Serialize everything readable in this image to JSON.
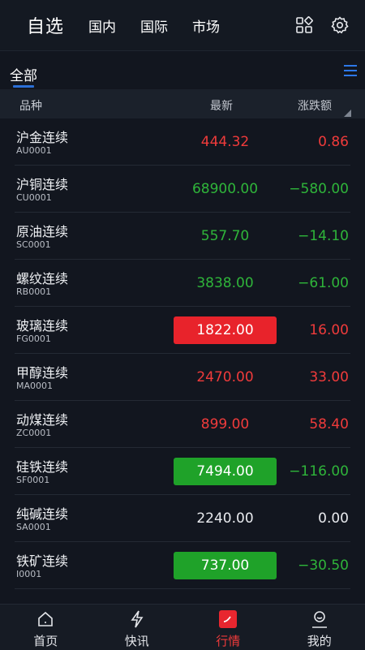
{
  "header": {
    "title": "自选",
    "nav": [
      "国内",
      "国际",
      "市场"
    ],
    "icons": [
      "grid-icon",
      "settings-icon"
    ]
  },
  "tabs": {
    "active": "全部"
  },
  "columns": {
    "name": "品种",
    "latest": "最新",
    "change": "涨跌额"
  },
  "rows": [
    {
      "name": "沪金连续",
      "code": "AU0001",
      "price": "444.32",
      "change": "0.86",
      "dir": "up",
      "highlight": false
    },
    {
      "name": "沪铜连续",
      "code": "CU0001",
      "price": "68900.00",
      "change": "−580.00",
      "dir": "down",
      "highlight": false
    },
    {
      "name": "原油连续",
      "code": "SC0001",
      "price": "557.70",
      "change": "−14.10",
      "dir": "down",
      "highlight": false
    },
    {
      "name": "螺纹连续",
      "code": "RB0001",
      "price": "3838.00",
      "change": "−61.00",
      "dir": "down",
      "highlight": false
    },
    {
      "name": "玻璃连续",
      "code": "FG0001",
      "price": "1822.00",
      "change": "16.00",
      "dir": "up",
      "highlight": true
    },
    {
      "name": "甲醇连续",
      "code": "MA0001",
      "price": "2470.00",
      "change": "33.00",
      "dir": "up",
      "highlight": false
    },
    {
      "name": "动煤连续",
      "code": "ZC0001",
      "price": "899.00",
      "change": "58.40",
      "dir": "up",
      "highlight": false
    },
    {
      "name": "硅铁连续",
      "code": "SF0001",
      "price": "7494.00",
      "change": "−116.00",
      "dir": "down",
      "highlight": true
    },
    {
      "name": "纯碱连续",
      "code": "SA0001",
      "price": "2240.00",
      "change": "0.00",
      "dir": "flat",
      "highlight": false
    },
    {
      "name": "铁矿连续",
      "code": "I0001",
      "price": "737.00",
      "change": "−30.50",
      "dir": "down",
      "highlight": true
    }
  ],
  "bottom_nav": [
    {
      "label": "首页",
      "icon": "home-icon",
      "active": false
    },
    {
      "label": "快讯",
      "icon": "flash-icon",
      "active": false
    },
    {
      "label": "行情",
      "icon": "market-icon",
      "active": true
    },
    {
      "label": "我的",
      "icon": "profile-icon",
      "active": false
    }
  ],
  "colors": {
    "up": "#f03b3b",
    "down": "#2fb53a",
    "accent": "#2b6fd6"
  }
}
